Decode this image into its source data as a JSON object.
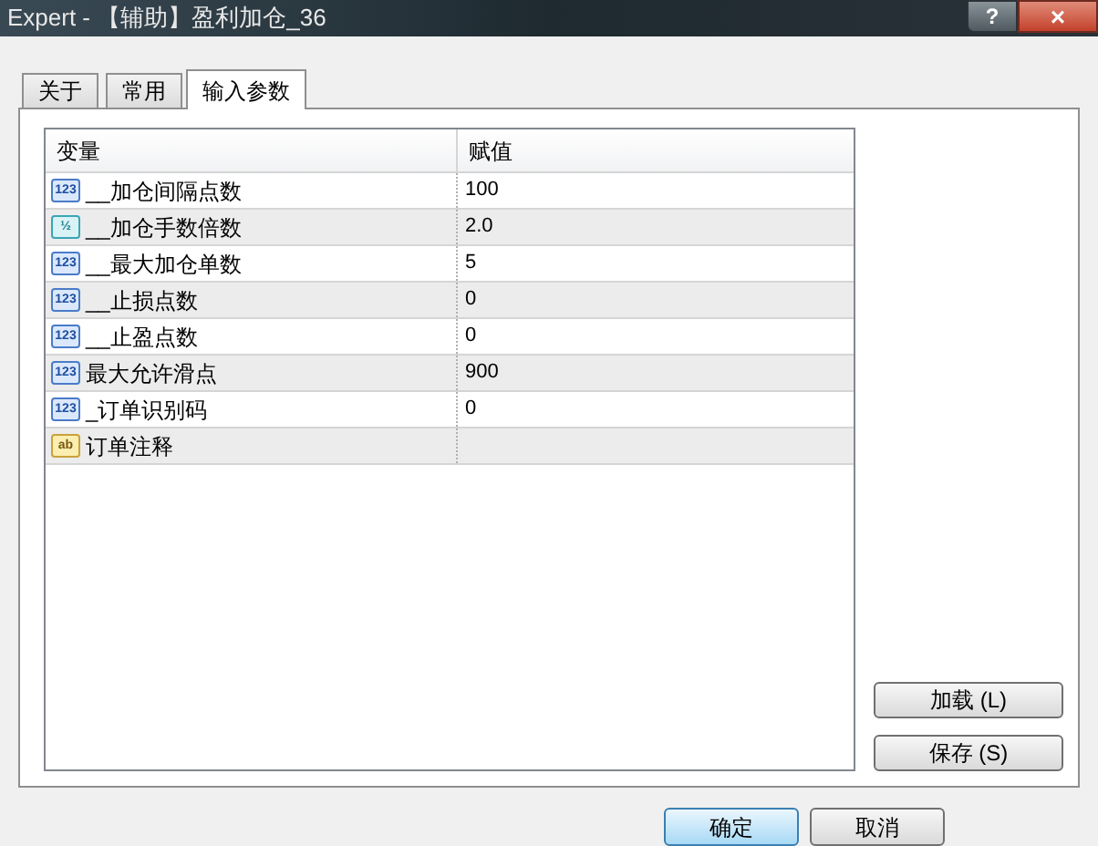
{
  "window": {
    "title": "Expert - 【辅助】盈利加仓_36"
  },
  "title_buttons": [
    "?",
    "×"
  ],
  "tabs": [
    {
      "label": "关于",
      "selected": false
    },
    {
      "label": "常用",
      "selected": false
    },
    {
      "label": "输入参数",
      "selected": true
    }
  ],
  "table": {
    "columns": [
      "变量",
      "赋值"
    ],
    "rows": [
      {
        "kind": "int",
        "icon_text": "123",
        "name": "__加仓间隔点数",
        "value": "100"
      },
      {
        "kind": "double",
        "icon_text": "½",
        "name": "__加仓手数倍数",
        "value": "2.0"
      },
      {
        "kind": "int",
        "icon_text": "123",
        "name": "__最大加仓单数",
        "value": "5"
      },
      {
        "kind": "int",
        "icon_text": "123",
        "name": "__止损点数",
        "value": "0"
      },
      {
        "kind": "int",
        "icon_text": "123",
        "name": "__止盈点数",
        "value": "0"
      },
      {
        "kind": "int",
        "icon_text": "123",
        "name": "最大允许滑点",
        "value": "900"
      },
      {
        "kind": "int",
        "icon_text": "123",
        "name": "_订单识别码",
        "value": "0"
      },
      {
        "kind": "string",
        "icon_text": "ab",
        "name": "订单注释",
        "value": ""
      }
    ]
  },
  "side_buttons": [
    "加载 (L)",
    "保存 (S)"
  ],
  "footer_buttons": [
    {
      "label": "确定",
      "selected": true
    },
    {
      "label": "取消",
      "selected": false
    }
  ]
}
